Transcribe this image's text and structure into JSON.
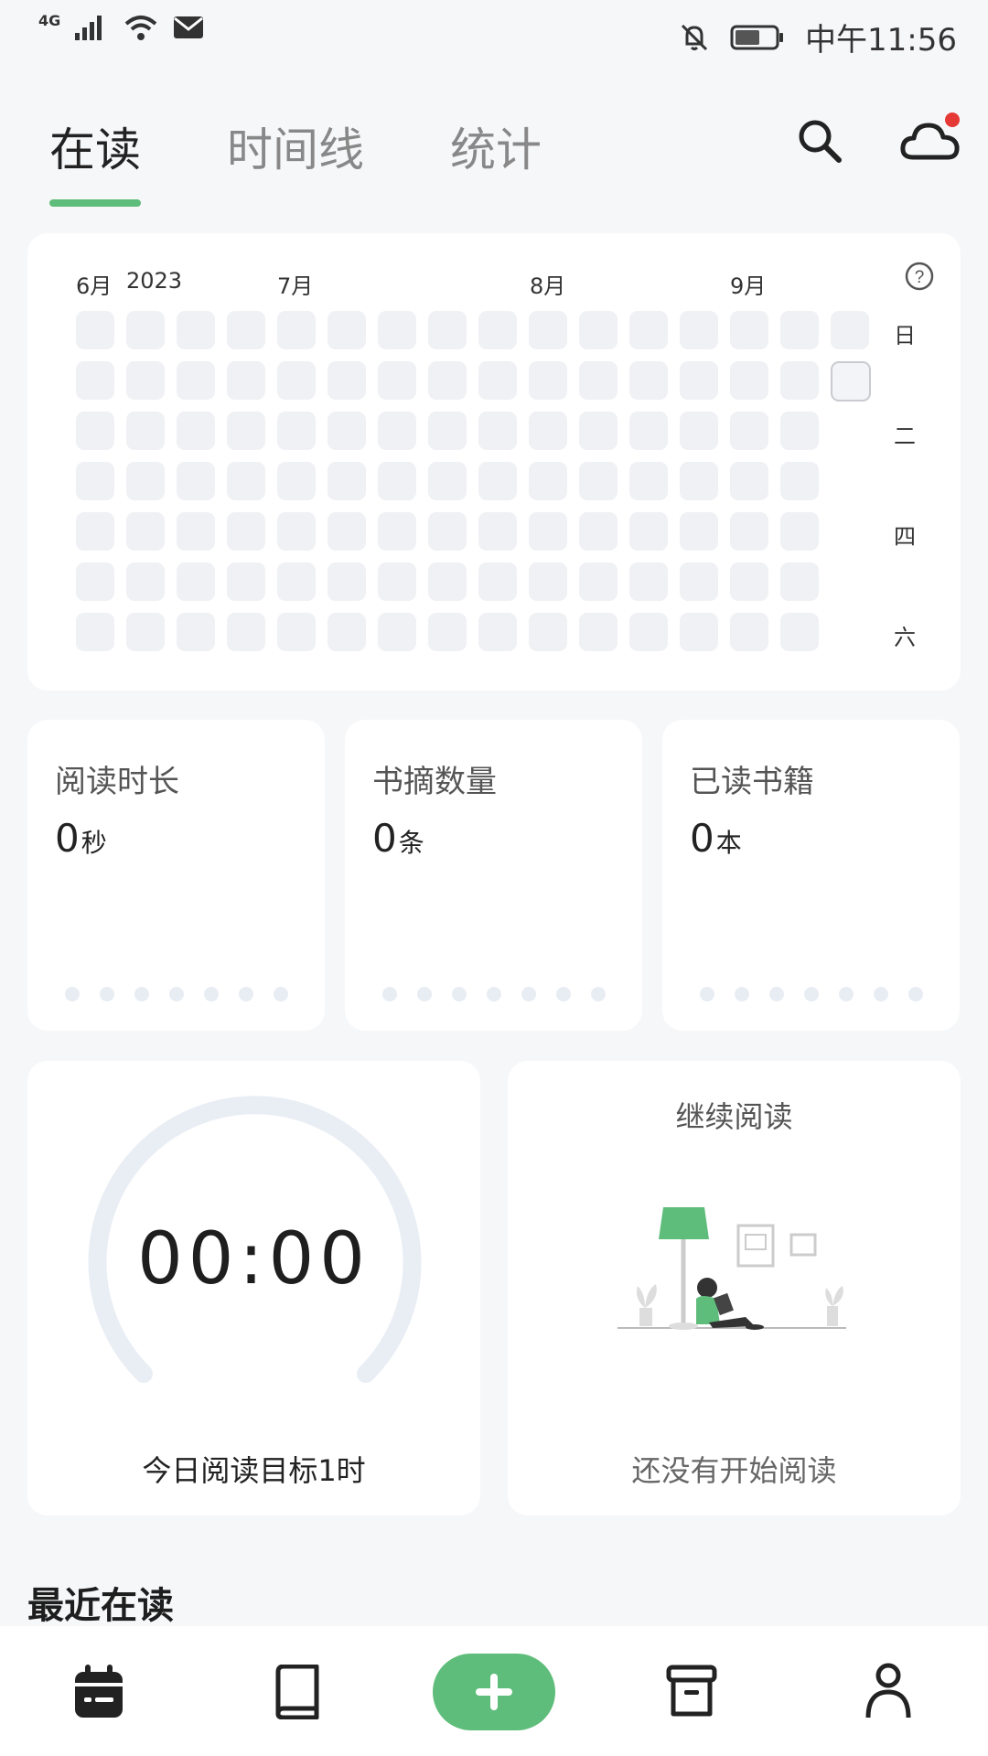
{
  "status_bar": {
    "network": "4G",
    "time": "中午11:56"
  },
  "tabs": [
    {
      "label": "在读",
      "active": true
    },
    {
      "label": "时间线",
      "active": false
    },
    {
      "label": "统计",
      "active": false
    }
  ],
  "top_icons": [
    "search-icon",
    "cloud-sync-icon"
  ],
  "heatmap": {
    "months": [
      "6月",
      "2023",
      "7月",
      "8月",
      "9月"
    ],
    "weekdays": [
      "日",
      "二",
      "四",
      "六"
    ]
  },
  "stats": [
    {
      "title": "阅读时长",
      "value": "0",
      "unit": "秒"
    },
    {
      "title": "书摘数量",
      "value": "0",
      "unit": "条"
    },
    {
      "title": "已读书籍",
      "value": "0",
      "unit": "本"
    }
  ],
  "timer": {
    "display": "00:00",
    "goal": "今日阅读目标1时"
  },
  "continue_reading": {
    "title": "继续阅读",
    "empty_text": "还没有开始阅读"
  },
  "recent": {
    "title": "最近在读"
  },
  "bottom_nav": [
    "calendar-icon",
    "book-icon",
    "add-button",
    "archive-icon",
    "profile-icon"
  ],
  "colors": {
    "accent": "#5fbd7b",
    "notification_dot": "#e53935",
    "cell": "#f0f1f4"
  }
}
